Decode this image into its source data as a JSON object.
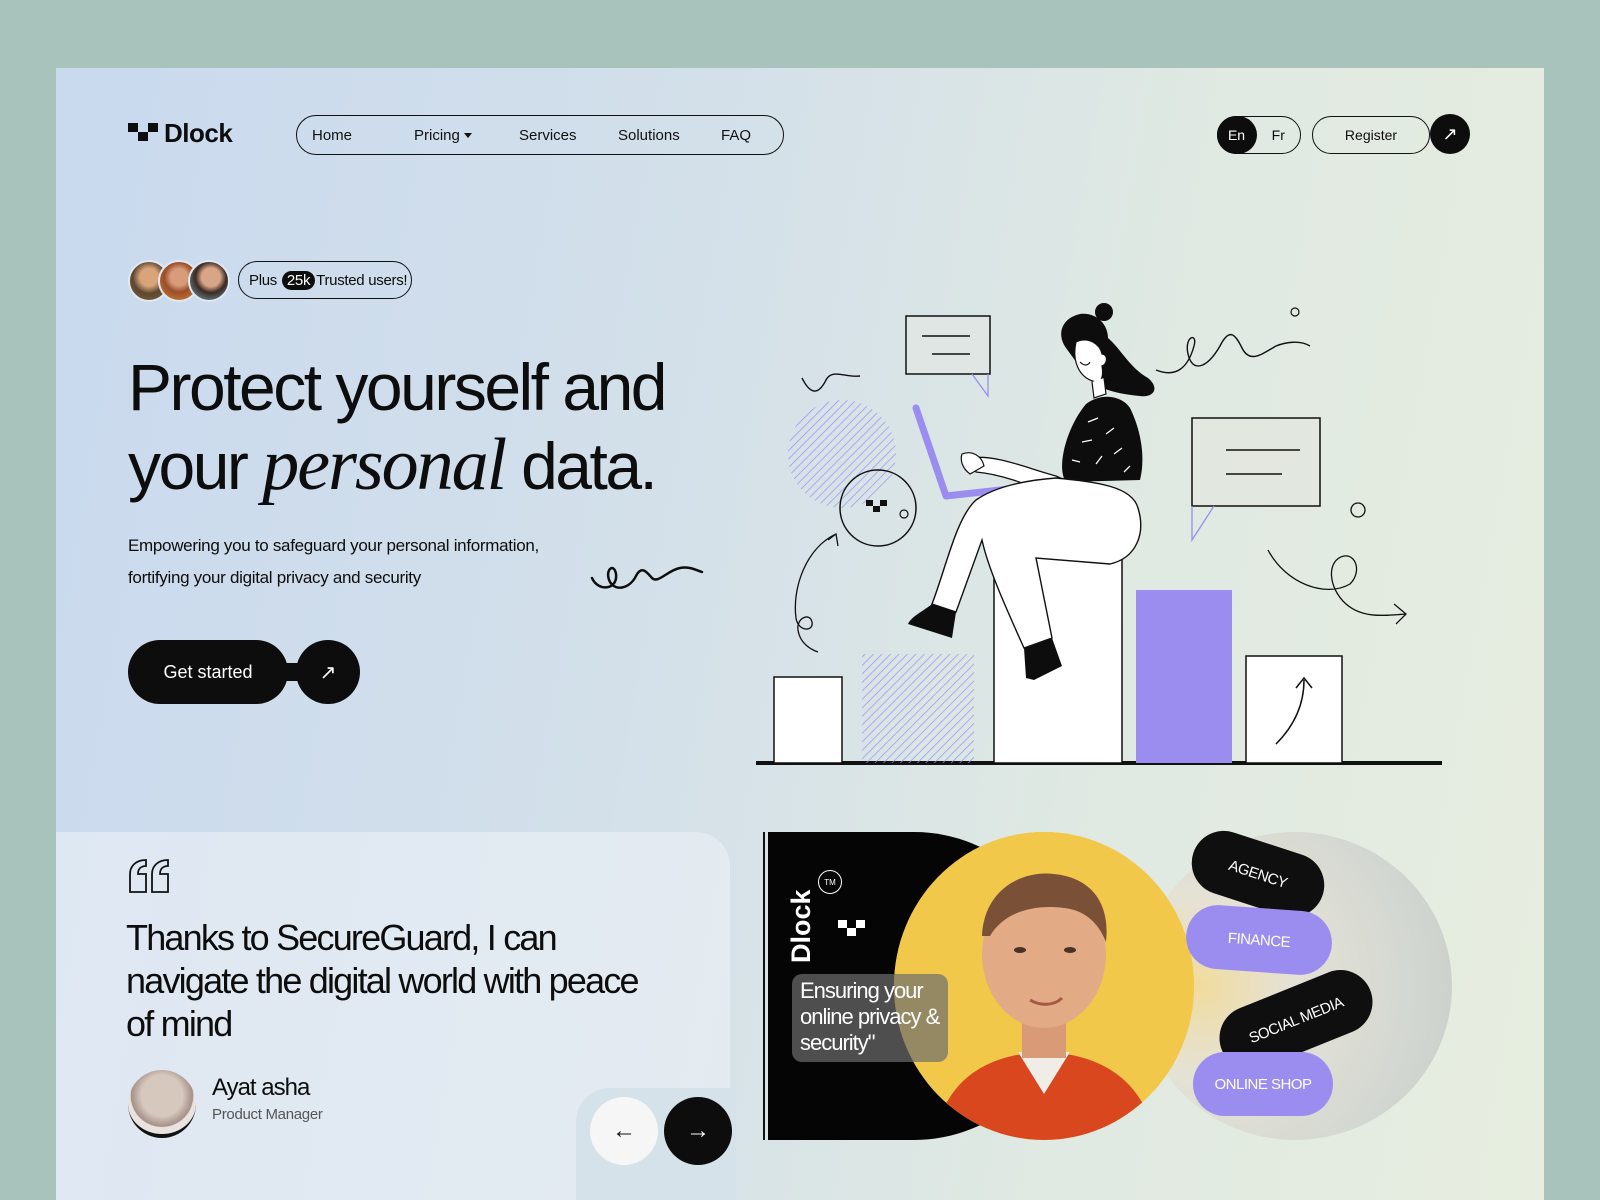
{
  "brand": {
    "name": "Dlock"
  },
  "nav": {
    "items": [
      {
        "label": "Home"
      },
      {
        "label": "Pricing",
        "has_dropdown": true
      },
      {
        "label": "Services"
      },
      {
        "label": "Solutions"
      },
      {
        "label": "FAQ"
      }
    ]
  },
  "header": {
    "languages": [
      "En",
      "Fr"
    ],
    "active_language": "En",
    "register_label": "Register",
    "register_arrow": "↗"
  },
  "trusted": {
    "prefix": "Plus",
    "count": "25k",
    "suffix": "Trusted users!"
  },
  "hero": {
    "headline_line1": "Protect yourself and",
    "headline_line2_start": "your",
    "headline_emphasis": "personal",
    "headline_line2_end": "data.",
    "subtitle_line1": "Empowering you to safeguard your personal information,",
    "subtitle_line2": "fortifying your digital privacy and security",
    "cta_label": "Get started",
    "cta_arrow": "↗"
  },
  "testimonial": {
    "quote": "Thanks to SecureGuard, I can navigate the digital world with peace of mind",
    "author_name": "Ayat asha",
    "author_role": "Product Manager",
    "prev_arrow": "←",
    "next_arrow": "→"
  },
  "showcase": {
    "brand_vertical": "Dlock",
    "tm": "TM",
    "tagline": "Ensuring your online privacy & security\"",
    "tags": [
      {
        "label": "AGENCY",
        "color": "#0f0f10"
      },
      {
        "label": "FINANCE",
        "color": "#9b8cf0"
      },
      {
        "label": "SOCIAL MEDIA",
        "color": "#0f0f10"
      },
      {
        "label": "ONLINE SHOP",
        "color": "#9b8cf0"
      }
    ]
  },
  "colors": {
    "accent_purple": "#9b8cf0",
    "ink": "#0d0d0d",
    "outer_bg": "#a8c2bc",
    "portrait_yellow": "#f2c84a"
  }
}
